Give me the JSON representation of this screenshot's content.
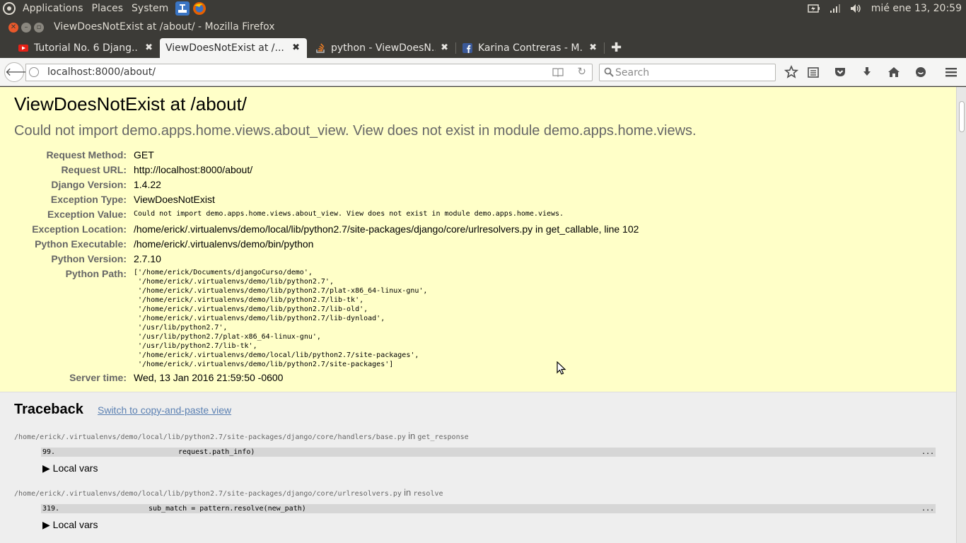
{
  "panel": {
    "menus": [
      "Applications",
      "Places",
      "System"
    ],
    "clock": "mié ene 13, 20:59"
  },
  "window": {
    "title": "ViewDoesNotExist at /about/ - Mozilla Firefox"
  },
  "tabs": [
    {
      "title": "Tutorial No. 6 Djang...",
      "close": "✖",
      "favicon_color": "#e62117"
    },
    {
      "title": "ViewDoesNotExist at /...",
      "close": "✖",
      "favicon_color": "none"
    },
    {
      "title": "python - ViewDoesN...",
      "close": "✖",
      "favicon_color": "#f48024"
    },
    {
      "title": "Karina Contreras - M...",
      "close": "✖",
      "favicon_color": "#3b5998"
    }
  ],
  "newtab_label": "✚",
  "navbar": {
    "back_glyph": "🡐",
    "url": "localhost:8000/about/",
    "reload_glyph": "↻",
    "search_placeholder": "Search"
  },
  "error": {
    "title": "ViewDoesNotExist at /about/",
    "subtitle": "Could not import demo.apps.home.views.about_view. View does not exist in module demo.apps.home.views.",
    "meta": [
      {
        "key": "Request Method:",
        "value": "GET"
      },
      {
        "key": "Request URL:",
        "value": "http://localhost:8000/about/"
      },
      {
        "key": "Django Version:",
        "value": "1.4.22"
      },
      {
        "key": "Exception Type:",
        "value": "ViewDoesNotExist"
      },
      {
        "key": "Exception Value:",
        "value": "Could not import demo.apps.home.views.about_view. View does not exist in module demo.apps.home.views."
      },
      {
        "key": "Exception Location:",
        "value": "/home/erick/.virtualenvs/demo/local/lib/python2.7/site-packages/django/core/urlresolvers.py in get_callable, line 102"
      },
      {
        "key": "Python Executable:",
        "value": "/home/erick/.virtualenvs/demo/bin/python"
      },
      {
        "key": "Python Version:",
        "value": "2.7.10"
      },
      {
        "key": "Python Path:",
        "value": ""
      },
      {
        "key": "Server time:",
        "value": "Wed, 13 Jan 2016 21:59:50 -0600"
      }
    ],
    "python_path": [
      "['/home/erick/Documents/djangoCurso/demo',",
      " '/home/erick/.virtualenvs/demo/lib/python2.7',",
      " '/home/erick/.virtualenvs/demo/lib/python2.7/plat-x86_64-linux-gnu',",
      " '/home/erick/.virtualenvs/demo/lib/python2.7/lib-tk',",
      " '/home/erick/.virtualenvs/demo/lib/python2.7/lib-old',",
      " '/home/erick/.virtualenvs/demo/lib/python2.7/lib-dynload',",
      " '/usr/lib/python2.7',",
      " '/usr/lib/python2.7/plat-x86_64-linux-gnu',",
      " '/usr/lib/python2.7/lib-tk',",
      " '/home/erick/.virtualenvs/demo/local/lib/python2.7/site-packages',",
      " '/home/erick/.virtualenvs/demo/lib/python2.7/site-packages']"
    ]
  },
  "traceback": {
    "title": "Traceback",
    "switch_link": "Switch to copy-and-paste view",
    "frames": [
      {
        "path": "/home/erick/.virtualenvs/demo/local/lib/python2.7/site-packages/django/core/handlers/base.py",
        "in_word": "in",
        "func": "get_response",
        "line_no": "99.",
        "code": "request.path_info)",
        "more": "...",
        "local_vars": "▶ Local vars"
      },
      {
        "path": "/home/erick/.virtualenvs/demo/local/lib/python2.7/site-packages/django/core/urlresolvers.py",
        "in_word": "in",
        "func": "resolve",
        "line_no": "319.",
        "code": "sub_match = pattern.resolve(new_path)",
        "more": "...",
        "local_vars": "▶ Local vars"
      }
    ]
  }
}
